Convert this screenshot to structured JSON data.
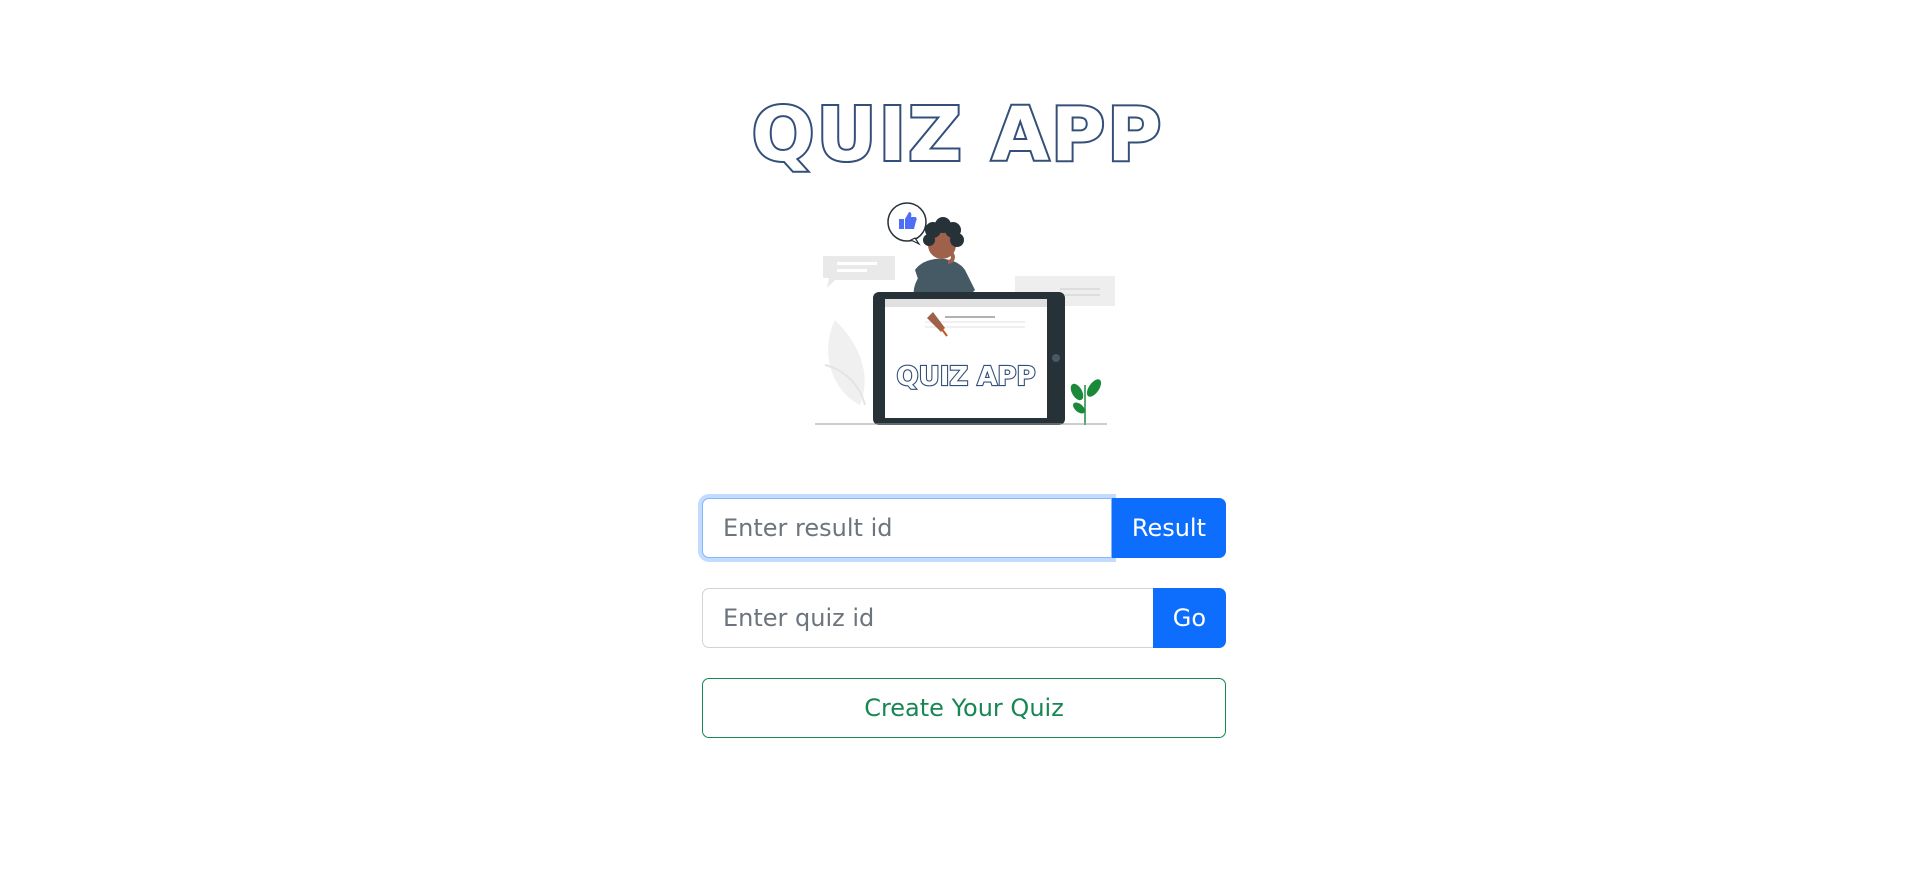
{
  "header": {
    "title": "QUIZ APP"
  },
  "illustration": {
    "screen_text": "QUIZ APP",
    "icon": "thumbs-up-icon"
  },
  "result_form": {
    "placeholder": "Enter result id",
    "value": "",
    "button_label": "Result"
  },
  "quiz_form": {
    "placeholder": "Enter quiz id",
    "value": "",
    "button_label": "Go"
  },
  "create_button": {
    "label": "Create Your Quiz"
  },
  "colors": {
    "title": "#334f7a",
    "primary": "#0d6efd",
    "success": "#198754"
  }
}
